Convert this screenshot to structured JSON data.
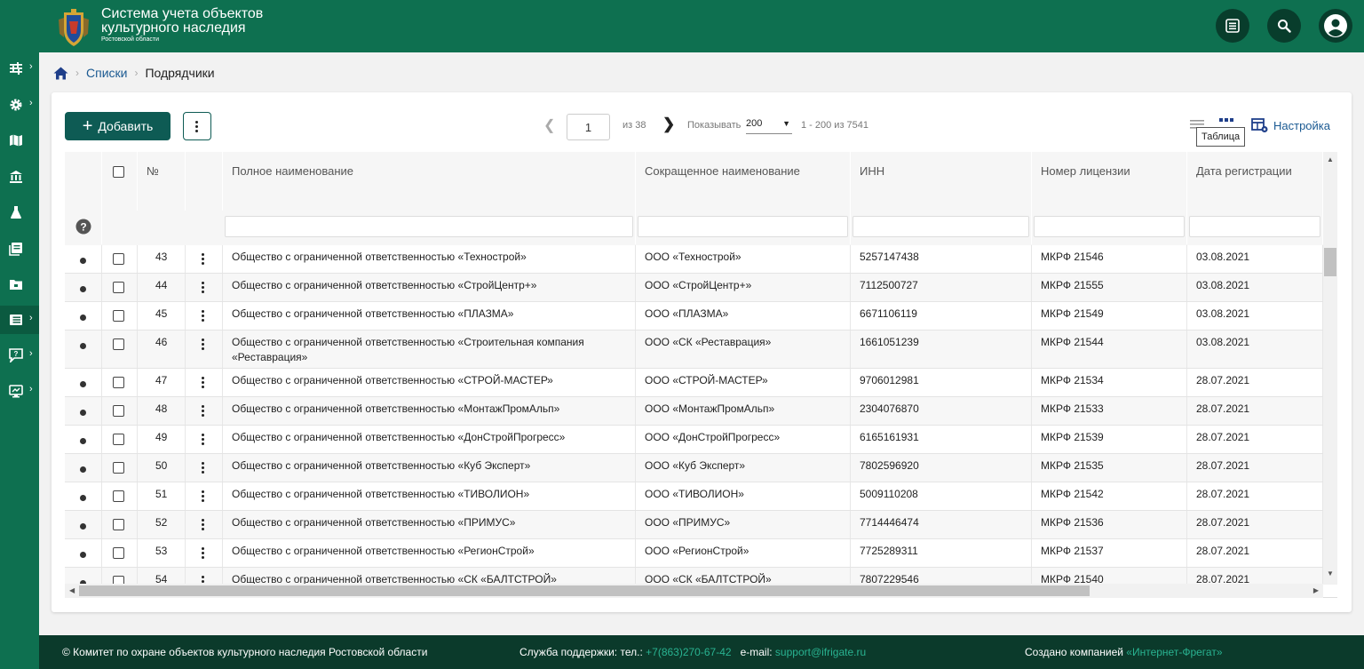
{
  "header": {
    "title_line1": "Система учета объектов",
    "title_line2": "культурного наследия",
    "title_line3": "Ростовской области"
  },
  "sidebar": {
    "items": [
      {
        "icon": "sliders-icon",
        "has_submenu": true
      },
      {
        "icon": "gear-icon",
        "has_submenu": true
      },
      {
        "icon": "map-icon",
        "has_submenu": false
      },
      {
        "icon": "museum-icon",
        "has_submenu": false
      },
      {
        "icon": "flask-icon",
        "has_submenu": false
      },
      {
        "icon": "book-icon",
        "has_submenu": false
      },
      {
        "icon": "folder-icon",
        "has_submenu": false
      },
      {
        "icon": "list-icon",
        "has_submenu": true,
        "active": true
      },
      {
        "icon": "help-chat-icon",
        "has_submenu": true
      },
      {
        "icon": "monitor-icon",
        "has_submenu": true
      }
    ]
  },
  "breadcrumb": {
    "home_icon": "home-icon",
    "items": [
      "Списки",
      "Подрядчики"
    ]
  },
  "toolbar": {
    "add_label": "Добавить",
    "page_value": "1",
    "of_text": "из  38",
    "show_label": "Показывать",
    "page_size": "200",
    "range_text": "1 - 200 из 7541",
    "settings_label": "Настройка",
    "tooltip": "Таблица"
  },
  "table": {
    "columns": [
      "№",
      "Полное наименование",
      "Сокращенное наименование",
      "ИНН",
      "Номер лицензии",
      "Дата регистрации"
    ],
    "rows": [
      {
        "n": "43",
        "full": "Общество с ограниченной ответственностью «Технострой»",
        "short": "ООО «Технострой»",
        "inn": "5257147438",
        "lic": "МКРФ 21546",
        "date": "03.08.2021"
      },
      {
        "n": "44",
        "full": "Общество с ограниченной ответственностью «СтройЦентр+»",
        "short": "ООО «СтройЦентр+»",
        "inn": "7112500727",
        "lic": "МКРФ 21555",
        "date": "03.08.2021"
      },
      {
        "n": "45",
        "full": "Общество с ограниченной ответственностью «ПЛАЗМА»",
        "short": "ООО «ПЛАЗМА»",
        "inn": "6671106119",
        "lic": "МКРФ 21549",
        "date": "03.08.2021"
      },
      {
        "n": "46",
        "full": "Общество с ограниченной ответственностью «Строительная компания «Реставрация»",
        "short": "ООО «СК «Реставрация»",
        "inn": "1661051239",
        "lic": "МКРФ 21544",
        "date": "03.08.2021"
      },
      {
        "n": "47",
        "full": "Общество с ограниченной ответственностью «СТРОЙ-МАСТЕР»",
        "short": "ООО «СТРОЙ-МАСТЕР»",
        "inn": "9706012981",
        "lic": "МКРФ 21534",
        "date": "28.07.2021"
      },
      {
        "n": "48",
        "full": "Общество с ограниченной ответственностью «МонтажПромАльп»",
        "short": "ООО «МонтажПромАльп»",
        "inn": "2304076870",
        "lic": "МКРФ 21533",
        "date": "28.07.2021"
      },
      {
        "n": "49",
        "full": "Общество с ограниченной ответственностью «ДонСтройПрогресс»",
        "short": "ООО «ДонСтройПрогресс»",
        "inn": "6165161931",
        "lic": "МКРФ 21539",
        "date": "28.07.2021"
      },
      {
        "n": "50",
        "full": "Общество с ограниченной ответственностью «Куб Эксперт»",
        "short": "ООО «Куб Эксперт»",
        "inn": "7802596920",
        "lic": "МКРФ 21535",
        "date": "28.07.2021"
      },
      {
        "n": "51",
        "full": "Общество с ограниченной ответственностью «ТИВОЛИОН»",
        "short": "ООО «ТИВОЛИОН»",
        "inn": "5009110208",
        "lic": "МКРФ 21542",
        "date": "28.07.2021"
      },
      {
        "n": "52",
        "full": "Общество с ограниченной ответственностью «ПРИМУС»",
        "short": "ООО «ПРИМУС»",
        "inn": "7714446474",
        "lic": "МКРФ 21536",
        "date": "28.07.2021"
      },
      {
        "n": "53",
        "full": "Общество с ограниченной ответственностью «РегионСтрой»",
        "short": "ООО «РегионСтрой»",
        "inn": "7725289311",
        "lic": "МКРФ 21537",
        "date": "28.07.2021"
      },
      {
        "n": "54",
        "full": "Общество с ограниченной ответственностью «СК «БАЛТСТРОЙ»",
        "short": "ООО «СК «БАЛТСТРОЙ»",
        "inn": "7807229546",
        "lic": "МКРФ 21540",
        "date": "28.07.2021"
      }
    ]
  },
  "footer": {
    "copyright": "© Комитет по охране объектов культурного наследия Ростовской области",
    "support_label": "Служба поддержки: тел.:",
    "phone": "+7(863)270-67-42",
    "email_label": "e-mail:",
    "email": "support@ifrigate.ru",
    "made_by_label": "Создано компанией",
    "made_by": "«Интернет-Фрегат»"
  },
  "colors": {
    "brand_green": "#0e7050",
    "footer_dark": "#0b3a2b",
    "button_teal": "#0e5b54",
    "link_blue": "#1b5a92",
    "footer_link": "#29b391"
  }
}
